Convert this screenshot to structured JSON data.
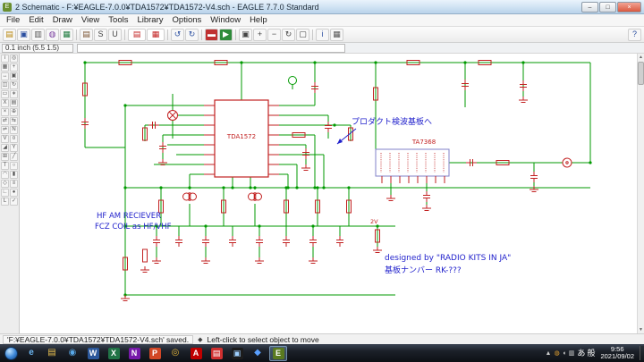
{
  "window": {
    "icon_glyph": "E",
    "title": "2 Schematic - F:¥EAGLE-7.0.0¥TDA1572¥TDA1572-V4.sch - EAGLE 7.7.0 Standard",
    "controls": [
      {
        "name": "minimize-button",
        "glyph": "–"
      },
      {
        "name": "maximize-button",
        "glyph": "□"
      },
      {
        "name": "close-button",
        "glyph": "×"
      }
    ]
  },
  "menu": {
    "items": [
      "File",
      "Edit",
      "Draw",
      "View",
      "Tools",
      "Library",
      "Options",
      "Window",
      "Help"
    ]
  },
  "toolbar": {
    "icons": [
      {
        "name": "open-button",
        "glyph": "▤",
        "fg": "#b8860b"
      },
      {
        "name": "save-button",
        "glyph": "▣",
        "fg": "#2b4fa0"
      },
      {
        "name": "print-button",
        "glyph": "▥",
        "fg": "#555555"
      },
      {
        "name": "cam-processor-button",
        "glyph": "◍",
        "fg": "#7a3fa0"
      },
      {
        "name": "switch-to-board-button",
        "glyph": "▦",
        "fg": "#1d7a3e"
      },
      {
        "sep": true
      },
      {
        "name": "library-button",
        "glyph": "▤",
        "fg": "#7a5230"
      },
      {
        "name": "script-button",
        "glyph": "S",
        "fg": "#444444"
      },
      {
        "name": "run-ulp-button",
        "glyph": "U",
        "fg": "#444444"
      },
      {
        "sep": true
      },
      {
        "name": "sheet-preview-button",
        "glyph": "▤",
        "fg": "#c22121",
        "wide": true
      },
      {
        "name": "board-preview-button",
        "glyph": "▦",
        "fg": "#c22121",
        "wide": true
      },
      {
        "sep": true
      },
      {
        "name": "undo-button",
        "glyph": "↺",
        "fg": "#2b4fa0"
      },
      {
        "name": "redo-button",
        "glyph": "↻",
        "fg": "#2b4fa0"
      },
      {
        "sep": true
      },
      {
        "name": "stop-button",
        "glyph": "▬",
        "fg": "#ffffff",
        "bg": "#c03030"
      },
      {
        "name": "go-button",
        "glyph": "▶",
        "fg": "#ffffff",
        "bg": "#2e8b3a"
      },
      {
        "sep": true
      },
      {
        "name": "zoom-fit-button",
        "glyph": "▣",
        "fg": "#444444"
      },
      {
        "name": "zoom-in-button",
        "glyph": "+",
        "fg": "#444444"
      },
      {
        "name": "zoom-out-button",
        "glyph": "−",
        "fg": "#444444"
      },
      {
        "name": "zoom-redraw-button",
        "glyph": "↻",
        "fg": "#444444"
      },
      {
        "name": "zoom-select-button",
        "glyph": "▢",
        "fg": "#444444"
      },
      {
        "sep": true
      },
      {
        "name": "info-button",
        "glyph": "i",
        "fg": "#2b4fa0"
      },
      {
        "name": "display-layers-button",
        "glyph": "▦",
        "fg": "#555555"
      },
      {
        "name": "help-button",
        "glyph": "?",
        "fg": "#2b4fa0",
        "right": true
      }
    ]
  },
  "coordbar": {
    "coordinates": "0.1 inch (5.5 1.5)",
    "command_value": ""
  },
  "palette": {
    "tools": [
      {
        "name": "tool-info",
        "glyph": "i"
      },
      {
        "name": "tool-show",
        "glyph": "◎"
      },
      {
        "name": "tool-display",
        "glyph": "▦"
      },
      {
        "name": "tool-mark",
        "glyph": "+"
      },
      {
        "name": "tool-move",
        "glyph": "↔"
      },
      {
        "name": "tool-copy",
        "glyph": "▣"
      },
      {
        "name": "tool-mirror",
        "glyph": "◫"
      },
      {
        "name": "tool-rotate",
        "glyph": "↻"
      },
      {
        "name": "tool-group",
        "glyph": "▭"
      },
      {
        "name": "tool-change",
        "glyph": "∗"
      },
      {
        "name": "tool-cut",
        "glyph": "X"
      },
      {
        "name": "tool-paste",
        "glyph": "▤"
      },
      {
        "name": "tool-delete",
        "glyph": "×"
      },
      {
        "name": "tool-add",
        "glyph": "⊕"
      },
      {
        "name": "tool-pinswap",
        "glyph": "⇄"
      },
      {
        "name": "tool-replace",
        "glyph": "⇆"
      },
      {
        "name": "tool-gateswap",
        "glyph": "⇌"
      },
      {
        "name": "tool-name",
        "glyph": "N"
      },
      {
        "name": "tool-value",
        "glyph": "V"
      },
      {
        "name": "tool-smash",
        "glyph": "¤"
      },
      {
        "name": "tool-miter",
        "glyph": "◢"
      },
      {
        "name": "tool-split",
        "glyph": "Y"
      },
      {
        "name": "tool-invoke",
        "glyph": "⊞"
      },
      {
        "name": "tool-wire",
        "glyph": "╱"
      },
      {
        "name": "tool-text",
        "glyph": "T"
      },
      {
        "name": "tool-circle",
        "glyph": "○"
      },
      {
        "name": "tool-arc",
        "glyph": "◠"
      },
      {
        "name": "tool-rect",
        "glyph": "▮"
      },
      {
        "name": "tool-polygon",
        "glyph": "◇"
      },
      {
        "name": "tool-bus",
        "glyph": "≡"
      },
      {
        "name": "tool-net",
        "glyph": "∟"
      },
      {
        "name": "tool-junction",
        "glyph": "●"
      },
      {
        "name": "tool-label",
        "glyph": "L"
      },
      {
        "name": "tool-erc",
        "glyph": "✓"
      }
    ]
  },
  "schematic": {
    "colors": {
      "net": "#009a00",
      "part": "#c22121",
      "note": "#2222cc",
      "ic2_box": "#8080c8"
    },
    "ic_main": "TDA1572",
    "ic_amp": "TA7368",
    "notes": {
      "product_detector": "プロダクト検波基板へ",
      "receiver_line1": "HF AM RECIEVER",
      "receiver_line2": "FCZ COIL as HF/VHF",
      "design_line1": "designed by \"RADIO KITS IN JA\"",
      "design_line2": "基板ナンバー RK-???"
    },
    "labels": {
      "voltage": "2V"
    }
  },
  "statusbar": {
    "file_message": "'F:¥EAGLE-7.0.0¥TDA1572¥TDA1572-V4.sch' saved.",
    "bullet": "◆",
    "hint": "Left-click to select object to move"
  },
  "taskbar": {
    "apps": [
      {
        "name": "taskbar-ie",
        "glyph": "e",
        "fg": "#6cb8f4"
      },
      {
        "name": "taskbar-explorer",
        "glyph": "▤",
        "fg": "#e8c050"
      },
      {
        "name": "taskbar-mediaplayer",
        "glyph": "◉",
        "fg": "#58a8e8"
      },
      {
        "name": "taskbar-word",
        "glyph": "W",
        "fg": "#ffffff",
        "bg": "#2b579a"
      },
      {
        "name": "taskbar-excel",
        "glyph": "X",
        "fg": "#ffffff",
        "bg": "#217346"
      },
      {
        "name": "taskbar-onenote",
        "glyph": "N",
        "fg": "#ffffff",
        "bg": "#7719aa"
      },
      {
        "name": "taskbar-powerpoint",
        "glyph": "P",
        "fg": "#ffffff",
        "bg": "#d24726"
      },
      {
        "name": "taskbar-chrome",
        "glyph": "◎",
        "fg": "#e8b83a"
      },
      {
        "name": "taskbar-acrobat",
        "glyph": "A",
        "fg": "#ffffff",
        "bg": "#c00000"
      },
      {
        "name": "taskbar-pdf",
        "glyph": "▤",
        "fg": "#ffffff",
        "bg": "#d03030"
      },
      {
        "name": "taskbar-app-dark",
        "glyph": "▣",
        "fg": "#9fd0ff",
        "bg": "#1c1c1c"
      },
      {
        "name": "taskbar-app-blue",
        "glyph": "◆",
        "fg": "#5aa0ff"
      },
      {
        "name": "taskbar-eagle",
        "glyph": "E",
        "fg": "#ffffff",
        "bg": "#5a7a20",
        "active": true
      }
    ],
    "tray_icons": [
      {
        "name": "tray-expand",
        "glyph": "▲",
        "fg": "#cccccc"
      },
      {
        "name": "tray-update",
        "glyph": "◍",
        "fg": "#e0a030"
      },
      {
        "name": "tray-volume",
        "glyph": "◖",
        "fg": "#dddddd"
      },
      {
        "name": "tray-network",
        "glyph": "▥",
        "fg": "#dddddd"
      }
    ],
    "ime": [
      "あ",
      "般"
    ],
    "clock": {
      "time": "9:56",
      "date": "2021/09/02"
    }
  }
}
